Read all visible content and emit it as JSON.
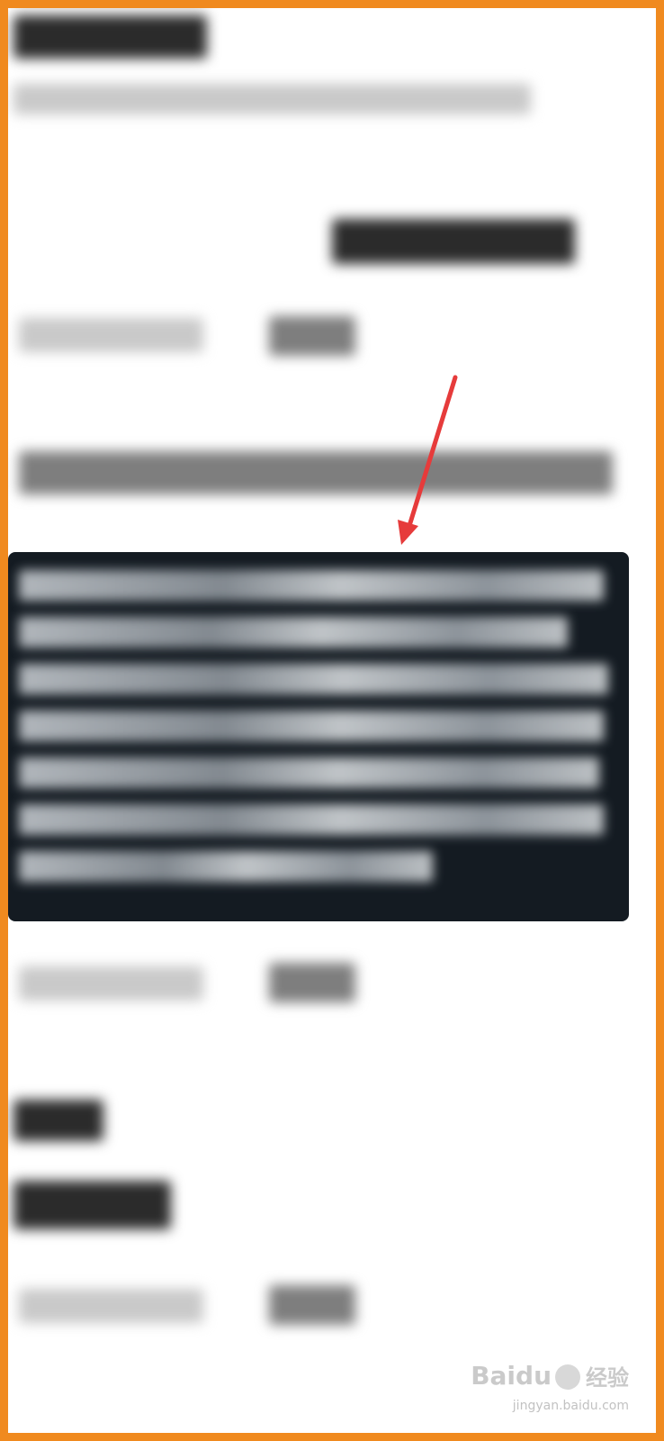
{
  "watermark": {
    "logo": "Baidu",
    "product": "经验",
    "url": "jingyan.baidu.com"
  },
  "colors": {
    "frame": "#f08a1f",
    "popup_bg": "#141b22",
    "arrow": "#e63b3b"
  },
  "icons": {
    "arrow": "red-arrow-icon",
    "paw": "baidu-paw-icon"
  }
}
